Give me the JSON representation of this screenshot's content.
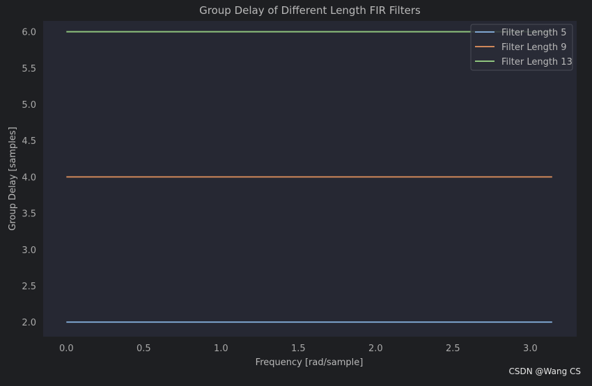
{
  "chart_data": {
    "type": "line",
    "title": "Group Delay of Different Length FIR Filters",
    "xlabel": "Frequency [rad/sample]",
    "ylabel": "Group Delay [samples]",
    "xlim": [
      -0.15,
      3.3
    ],
    "ylim": [
      1.8,
      6.15
    ],
    "xticks": [
      0.0,
      0.5,
      1.0,
      1.5,
      2.0,
      2.5,
      3.0
    ],
    "yticks": [
      2.0,
      2.5,
      3.0,
      3.5,
      4.0,
      4.5,
      5.0,
      5.5,
      6.0
    ],
    "grid": false,
    "legend_position": "top-right",
    "x": [
      0.0,
      3.14159
    ],
    "series": [
      {
        "name": "Filter Length 5",
        "values": [
          2.0,
          2.0
        ],
        "color": "#7ea4cf"
      },
      {
        "name": "Filter Length 9",
        "values": [
          4.0,
          4.0
        ],
        "color": "#d0875a"
      },
      {
        "name": "Filter Length 13",
        "values": [
          6.0,
          6.0
        ],
        "color": "#8fc47e"
      }
    ],
    "colors": {
      "page_bg": "#1e1f22",
      "plot_bg": "#262833",
      "text": "#b9b9b9",
      "axis_text": "#a9a9a9"
    }
  },
  "watermark": "CSDN @Wang CS"
}
